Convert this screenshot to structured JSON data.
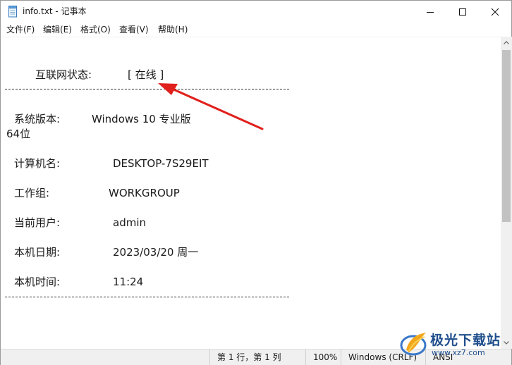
{
  "window": {
    "title": "info.txt - 记事本",
    "icon": "notepad-icon"
  },
  "menu": [
    "文件(F)",
    "编辑(E)",
    "格式(O)",
    "查看(V)",
    "帮助(H)"
  ],
  "content": {
    "internet_label": "互联网状态:",
    "internet_value": "[ 在线 ]",
    "os_label": "系统版本:",
    "os_value": "Windows 10 专业版",
    "os_wrap": "64位",
    "computer_label": "计算机名:",
    "computer_value": "DESKTOP-7S29EIT",
    "workgroup_label": "工作组:",
    "workgroup_value": "WORKGROUP",
    "user_label": "当前用户:",
    "user_value": "admin",
    "date_label": "本机日期:",
    "date_value": "2023/03/20 周一",
    "time_label": "本机时间:",
    "time_value": "11:24"
  },
  "status": {
    "position": "第 1 行，第 1 列",
    "zoom": "100%",
    "line_ending": "Windows (CRLF)",
    "encoding": "ANSI"
  },
  "annotation": {
    "arrow_color": "#e0201c"
  },
  "watermark": {
    "title": "极光下载站",
    "url": "www.xz7.com"
  }
}
